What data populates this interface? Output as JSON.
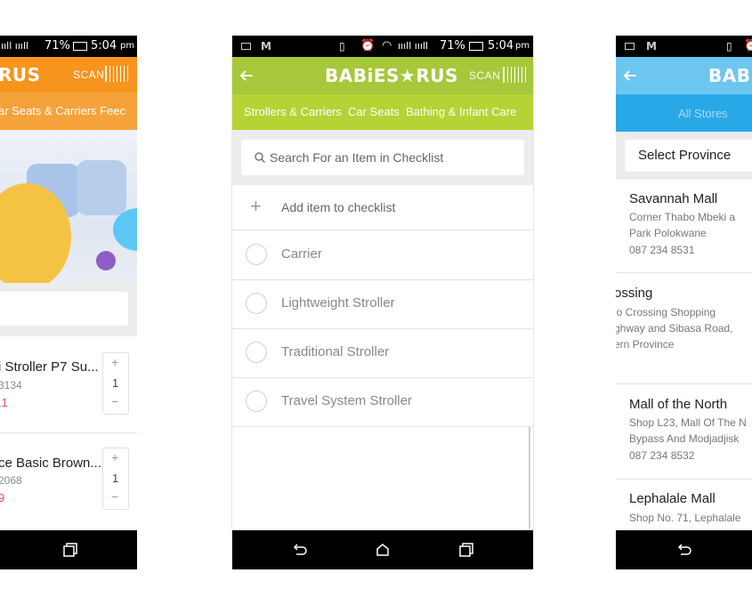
{
  "status": {
    "left_percent": "71%",
    "left_time": "5:04",
    "center_percent": "71%",
    "center_time": "5:04",
    "center_ampm": "pm"
  },
  "left_screen": {
    "logo": "RUS",
    "scan": "SCAN",
    "categories": "ar Seats & Carriers  Feec",
    "products": [
      {
        "name": "i Stroller P7 Su...",
        "sku": "3134",
        "price": ".1",
        "qty": "1",
        "plus": "+",
        "minus": "−"
      },
      {
        "name": "ce Basic Brown...",
        "sku": "2068",
        "price": "9",
        "qty": "1",
        "plus": "+",
        "minus": "−"
      }
    ]
  },
  "checklist_screen": {
    "logo": "BABiES★RUS",
    "scan": "SCAN",
    "tabs": [
      "Strollers & Carriers",
      "Car Seats",
      "Bathing & Infant Care"
    ],
    "search_placeholder": "Search For an Item in Checklist",
    "add_item_label": "Add item to checklist",
    "items": [
      "Carrier",
      "Lightweight Stroller",
      "Traditional Stroller",
      "Travel System Stroller"
    ]
  },
  "stores_screen": {
    "logo": "BABi",
    "tab_label": "All Stores",
    "province_select": "Select Province",
    "stores": [
      {
        "name": "Savannah Mall",
        "lines": [
          "Corner Thabo Mbeki a",
          "Park Polokwane",
          "087 234 8531"
        ]
      },
      {
        "name": "ossing",
        "lines": [
          "lo Crossing Shopping",
          "ghway and Sibasa Road,",
          "ern Province"
        ]
      },
      {
        "name": "Mall of the North",
        "lines": [
          "Shop L23, Mall Of The N",
          "Bypass And Modjadjisk",
          "087 234 8532"
        ]
      },
      {
        "name": "Lephalale Mall",
        "lines": [
          "Shop No. 71, Lephalale"
        ]
      }
    ]
  },
  "colors": {
    "left_header": "#f7941d",
    "checklist_header": "#a6c83a",
    "checklist_tabs": "#b5d334",
    "stores_header": "#6cc6f0",
    "stores_tab": "#29a8e8",
    "price_pink": "#e8417a"
  }
}
